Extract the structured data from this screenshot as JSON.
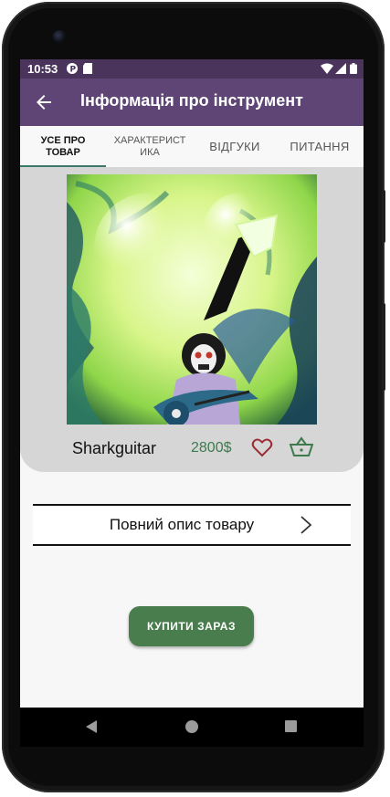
{
  "status_bar": {
    "time": "10:53",
    "icons": [
      "app-icon-p",
      "sd-card-icon",
      "wifi-icon",
      "signal-icon",
      "battery-icon"
    ]
  },
  "app_bar": {
    "title": "Інформація про інструмент",
    "back_icon": "arrow-left-icon"
  },
  "tabs": [
    {
      "label": "УСЕ ПРО ТОВАР",
      "active": true
    },
    {
      "label": "ХАРАКТЕРИСТИКА",
      "active": false
    },
    {
      "label": "ВІДГУКИ",
      "active": false
    },
    {
      "label": "ПИТАННЯ",
      "active": false
    }
  ],
  "product": {
    "name": "Sharkguitar",
    "price": "2800$",
    "image_icon": "product-artwork",
    "favorite_icon": "heart-outline-icon",
    "cart_icon": "basket-icon"
  },
  "description_row": {
    "label": "Повний опис товару",
    "chevron_icon": "chevron-right-icon"
  },
  "buy_button": {
    "label": "КУПИТИ ЗАРАЗ"
  },
  "colors": {
    "app_bar": "#5e4576",
    "status_bar": "#4a345c",
    "price": "#3e7a4d",
    "buy_button": "#4a7d4e",
    "heart": "#9b2c35",
    "tab_indicator": "#3b7a6a"
  }
}
